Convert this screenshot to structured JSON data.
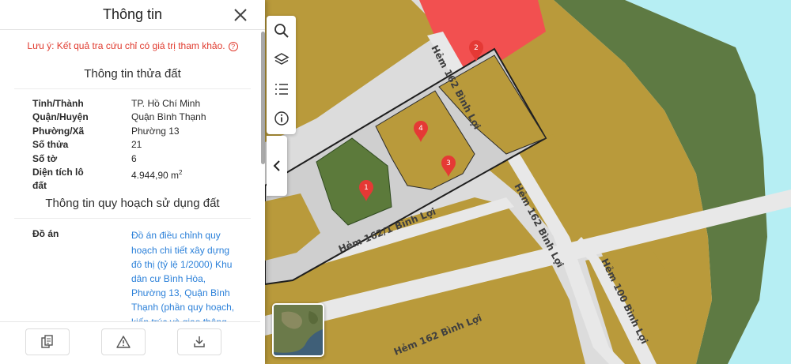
{
  "panel": {
    "title": "Thông tin",
    "notice": "Lưu ý: Kết quả tra cứu chỉ có giá trị tham khảo.",
    "parcel_section_title": "Thông tin thửa đất",
    "parcel_info": [
      {
        "label": "Tỉnh/Thành",
        "value": "TP. Hồ Chí Minh"
      },
      {
        "label": "Quận/Huyện",
        "value": "Quận Bình Thạnh"
      },
      {
        "label": "Phường/Xã",
        "value": "Phường 13"
      },
      {
        "label": "Số thửa",
        "value": "21"
      },
      {
        "label": "Số tờ",
        "value": "6"
      },
      {
        "label": "Diện tích lô đất",
        "value": "4.944,90 m",
        "unit_sup": "2"
      }
    ],
    "planning_section_title": "Thông tin quy hoạch sử dụng đất",
    "plan_label": "Đồ án",
    "plan_link_text": "Đồ án điều chỉnh quy hoạch chi tiết xây dựng đô thị (tỷ lệ 1/2000) Khu dân cư Bình Hòa, Phường 13, Quận Bình Thạnh (phần quy hoạch, kiến trúc và giao thông đính kèm bản đồ)",
    "plan_link_arrow": "➔",
    "footer_buttons": [
      "copy-icon",
      "warning-icon",
      "download-icon"
    ]
  },
  "map": {
    "tools": [
      "search-icon",
      "layers-icon",
      "list-icon",
      "info-icon"
    ],
    "streets": [
      "Hẻm 162 Bình Lợi",
      "Hẻm 162/1 Bình Lợi",
      "Hẻm 162 Bình Lợi",
      "Hẻm 100 Bình Lợi",
      "Hẻm 162 Bình Lợi"
    ],
    "markers": [
      "1",
      "2",
      "3",
      "4"
    ],
    "colors": {
      "residential": "#b99a3b",
      "residential_dark": "#a9892e",
      "green": "#5c7a3b",
      "river_green": "#5e7a43",
      "water": "#b5f0f5",
      "commercial": "#f25050",
      "road": "#dadada",
      "marker": "#e53935",
      "link": "#2b80d9",
      "notice": "#e03a2e"
    }
  }
}
